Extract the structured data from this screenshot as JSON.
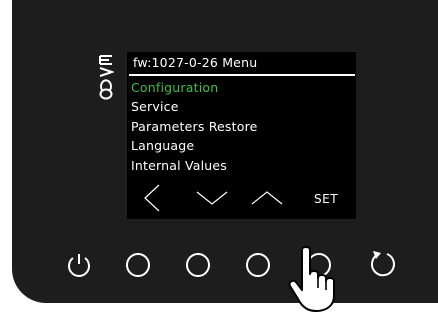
{
  "device": {
    "brand_logo": "EVCO",
    "screen": {
      "title": "fw:1027-0-26 Menu",
      "menu_items": [
        {
          "label": "Configuration",
          "selected": true
        },
        {
          "label": "Service",
          "selected": false
        },
        {
          "label": "Parameters Restore",
          "selected": false
        },
        {
          "label": "Language",
          "selected": false
        },
        {
          "label": "Internal Values",
          "selected": false
        }
      ],
      "soft_keys": [
        "left-chevron-icon",
        "down-chevron-icon",
        "up-chevron-icon",
        "SET"
      ],
      "set_label": "SET"
    },
    "buttons": [
      {
        "icon": "power-icon"
      },
      {
        "icon": "circle-icon"
      },
      {
        "icon": "circle-icon"
      },
      {
        "icon": "circle-icon"
      },
      {
        "icon": "circle-icon",
        "pressed": true
      },
      {
        "icon": "refresh-icon"
      }
    ],
    "colors": {
      "panel": "#1d1d1d",
      "screen": "#000000",
      "selected_text": "#3fc03f",
      "text": "#ffffff",
      "button_outline": "#ffffff"
    }
  }
}
